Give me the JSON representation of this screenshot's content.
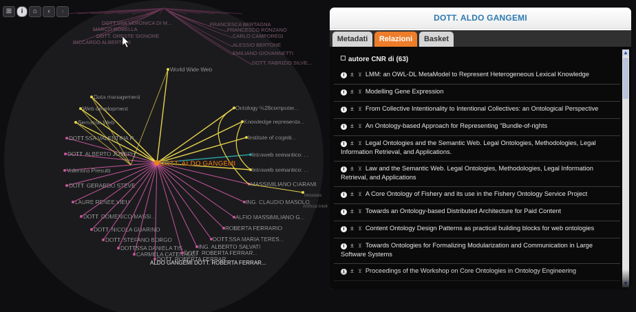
{
  "toolbar": {
    "btn1": "⊞",
    "btn2": "i",
    "btn3": "⌂",
    "btn4": "‹",
    "btn5": "›"
  },
  "graph": {
    "center_label": "DOTT. ALDO GANGEMI",
    "colors": {
      "author_edge": "#c7559c",
      "topic_edge": "#e8d44a",
      "center": "#e8811f",
      "project_edge": "#2aa3a3"
    },
    "left_nodes": [
      "World Wide Web",
      "Data management",
      "Web development",
      "Semantic Web",
      "DOTT.SSA VALENTINA P...",
      "DOTT. ALBERTO JOSEPH...",
      "Valentina Presutti",
      "DOTT. GERARDO STEVE",
      "LAURE RENEE VIEU",
      "DOTT. DOMENICO MASSI...",
      "DOTT. NICOLA GUARINO",
      "DOTT. STEFANO BORGO",
      "DOTTSSA DANIELA TIS...",
      "CARMELA CATENACCI",
      "DOTT. ROBERTA FERRAR..."
    ],
    "right_nodes": [
      "Ontology %28computer...",
      "Knowledge representa...",
      "Institute of cogniti...",
      "Intraweb semantico: ...",
      "Intraweb semantico: ...",
      "MASSIMILIANO CIARAMI",
      "ING. CLAUDIO MASOLO",
      "ALFIO MASSIMILIANO G...",
      "ROBERTA FERRARIO",
      "DOTT.SSA MARIA TERES...",
      "ING. ALBERTO SALVATI",
      "DOTT. ROBERTA FERRAR..."
    ],
    "bottom_labels": [
      "ALDO GANGEMI DOTT. ROBERTA FERRAR..."
    ],
    "top_nodes": [
      "DOTT.SSA VERONICA DI M...",
      "MARCO ROBELLA",
      "DOTT. ORESTE SIGNORE",
      "RICCARDO ALBERTONI",
      "FRANCESCA BERTAGNA",
      "FRANCESCO RONZANO",
      "CARLO CAMPOREGI",
      "ALESSIO BERTONE",
      "EMILIANO GIOVANNETTI",
      "DOTT. FABRIZIO SILVE..."
    ],
    "side_hints": [
      "Metadata",
      "Artificial Intellige"
    ]
  },
  "panel": {
    "title": "DOTT. ALDO GANGEMI",
    "tabs": [
      "Metadati",
      "Relazioni",
      "Basket"
    ],
    "active_tab": "Relazioni",
    "section_heading": "autore CNR di (63)",
    "publications": [
      "LMM: an OWL-DL MetaModel to Represent Heterogeneous Lexical Knowledge",
      "Modelling Gene Expression",
      "From Collective Intentionality to Intentional Collectives: an Ontological Perspective",
      "An Ontology-based Approach for Representing \"Bundle-of-rights",
      "Legal Ontologies and the Semantic Web. Legal Ontologies, Methodologies, Legal Information Retrieval, and Applications.",
      "Law and the Semantic Web. Legal Ontologies, Methodologies, Legal Information Retrieval, and Applications",
      "A Core Ontology of Fishery and its use in the Fishery Ontology Service Project",
      "Towards an Ontology-based Distributed Architecture for Paid Content",
      "Content Ontology Design Patterns as practical building blocks for web ontologies",
      "Towards Ontologies for Formalizing Modularization and Communication in Large Software Systems",
      "Proceedings of the Workshop on Core Ontologies in Ontology Engineering"
    ],
    "icons": {
      "info": "info-icon",
      "add": "plus-minus-icon",
      "basket": "cart-icon"
    }
  }
}
